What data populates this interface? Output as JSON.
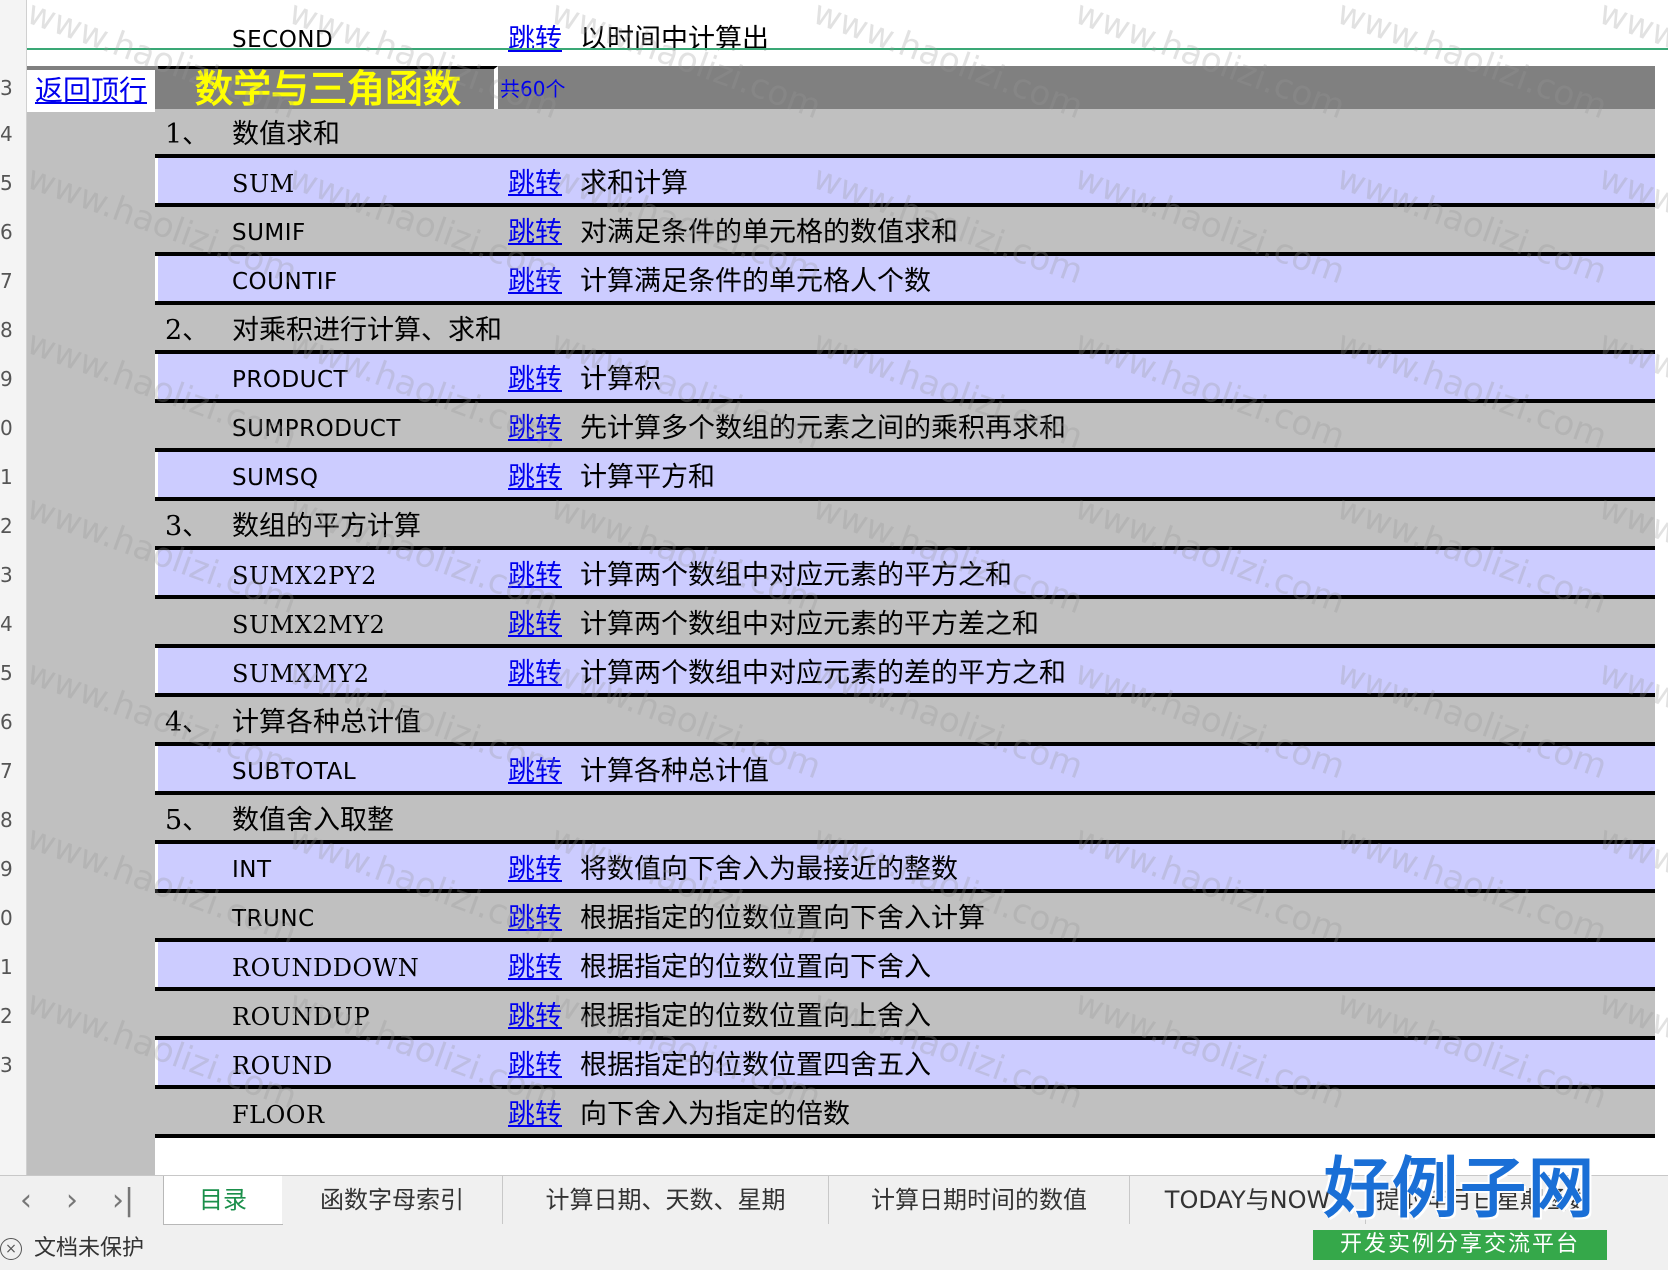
{
  "header": {
    "back_link": "返回顶行",
    "title": "数学与三角函数",
    "count": "共60个"
  },
  "partial_top_row": {
    "function": "SECOND",
    "jump": "跳转",
    "desc": "以时间中计算出"
  },
  "row_numbers": [
    "3",
    "4",
    "5",
    "6",
    "7",
    "8",
    "9",
    "0",
    "1",
    "2",
    "3",
    "4",
    "5",
    "6",
    "7",
    "8",
    "9",
    "0",
    "1",
    "2",
    "3"
  ],
  "rows": [
    {
      "kind": "section",
      "num": "1、",
      "title": "数值求和",
      "bg": "gray"
    },
    {
      "kind": "func",
      "name": "SUM",
      "font": "serif",
      "jump": "跳转",
      "desc": "求和计算",
      "bg": "lav"
    },
    {
      "kind": "func",
      "name": "SUMIF",
      "font": "sans",
      "jump": "跳转",
      "desc": "对满足条件的单元格的数值求和",
      "bg": "gray"
    },
    {
      "kind": "func",
      "name": "COUNTIF",
      "font": "sans",
      "jump": "跳转",
      "desc": "计算满足条件的单元格人个数",
      "bg": "lav"
    },
    {
      "kind": "section",
      "num": "2、",
      "title": "对乘积进行计算、求和",
      "bg": "gray"
    },
    {
      "kind": "func",
      "name": "PRODUCT",
      "font": "sans",
      "jump": "跳转",
      "desc": "计算积",
      "bg": "lav"
    },
    {
      "kind": "func",
      "name": "SUMPRODUCT",
      "font": "sans",
      "jump": "跳转",
      "desc": "先计算多个数组的元素之间的乘积再求和",
      "bg": "gray"
    },
    {
      "kind": "func",
      "name": "SUMSQ",
      "font": "sans",
      "jump": "跳转",
      "desc": "计算平方和",
      "bg": "lav"
    },
    {
      "kind": "section",
      "num": "3、",
      "title": "数组的平方计算",
      "bg": "gray"
    },
    {
      "kind": "func",
      "name": "SUMX2PY2",
      "font": "serif",
      "jump": "跳转",
      "desc": "计算两个数组中对应元素的平方之和",
      "bg": "lav"
    },
    {
      "kind": "func",
      "name": "SUMX2MY2",
      "font": "serif",
      "jump": "跳转",
      "desc": "计算两个数组中对应元素的平方差之和",
      "bg": "gray"
    },
    {
      "kind": "func",
      "name": "SUMXMY2",
      "font": "serif",
      "jump": "跳转",
      "desc": "计算两个数组中对应元素的差的平方之和",
      "bg": "lav"
    },
    {
      "kind": "section",
      "num": "4、",
      "title": "计算各种总计值",
      "bg": "gray"
    },
    {
      "kind": "func",
      "name": "SUBTOTAL",
      "font": "sans",
      "jump": "跳转",
      "desc": "计算各种总计值",
      "bg": "lav"
    },
    {
      "kind": "section",
      "num": "5、",
      "title": "数值舍入取整",
      "bg": "gray"
    },
    {
      "kind": "func",
      "name": "INT",
      "font": "sans",
      "jump": "跳转",
      "desc": "将数值向下舍入为最接近的整数",
      "bg": "lav"
    },
    {
      "kind": "func",
      "name": "TRUNC",
      "font": "sans",
      "jump": "跳转",
      "desc": "根据指定的位数位置向下舍入计算",
      "bg": "gray"
    },
    {
      "kind": "func",
      "name": "ROUNDDOWN",
      "font": "serif",
      "jump": "跳转",
      "desc": "根据指定的位数位置向下舍入",
      "bg": "lav"
    },
    {
      "kind": "func",
      "name": "ROUNDUP",
      "font": "serif",
      "jump": "跳转",
      "desc": "根据指定的位数位置向上舍入",
      "bg": "gray"
    },
    {
      "kind": "func",
      "name": "ROUND",
      "font": "serif",
      "jump": "跳转",
      "desc": "根据指定的位数位置四舍五入",
      "bg": "lav"
    },
    {
      "kind": "func",
      "name": "FLOOR",
      "font": "serif",
      "jump": "跳转",
      "desc": "向下舍入为指定的倍数",
      "bg": "gray"
    }
  ],
  "tabs": {
    "nav_first": "‹",
    "nav_prev": "‹",
    "nav_next": "›",
    "nav_last": "›|",
    "items": [
      "目录",
      "函数字母索引",
      "计算日期、天数、星期",
      "计算日期时间的数值",
      "TODAY与NOW",
      "提取年月日星期函数"
    ]
  },
  "status": {
    "text": "文档未保护"
  },
  "watermark": "www.haolizi.com",
  "logo": {
    "main": "好例子网",
    "sub": "开发实例分享交流平台"
  },
  "colors": {
    "lavender": "#ccccff",
    "gray": "#c0c0c0",
    "header_gray": "#808080",
    "title_yellow": "#ffff00",
    "link_blue": "#0000ee",
    "active_tab_green": "#1a8f4a"
  }
}
